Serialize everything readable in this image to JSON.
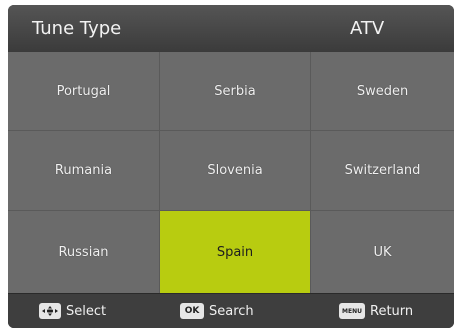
{
  "header": {
    "title": "Tune Type",
    "value": "ATV"
  },
  "countries": [
    [
      "Portugal",
      "Serbia",
      "Sweden"
    ],
    [
      "Rumania",
      "Slovenia",
      "Switzerland"
    ],
    [
      "Russian",
      "Spain",
      "UK"
    ]
  ],
  "selected_country": "Spain",
  "colors": {
    "selected": "#b8cc10",
    "cell": "#6b6b6b",
    "header": "#4a4a4a",
    "footer": "#3e3e3e"
  },
  "footer": {
    "select": {
      "key_icon": "dpad-icon",
      "label": "Select"
    },
    "search": {
      "key": "OK",
      "label": "Search"
    },
    "return": {
      "key": "MENU",
      "label": "Return"
    }
  }
}
